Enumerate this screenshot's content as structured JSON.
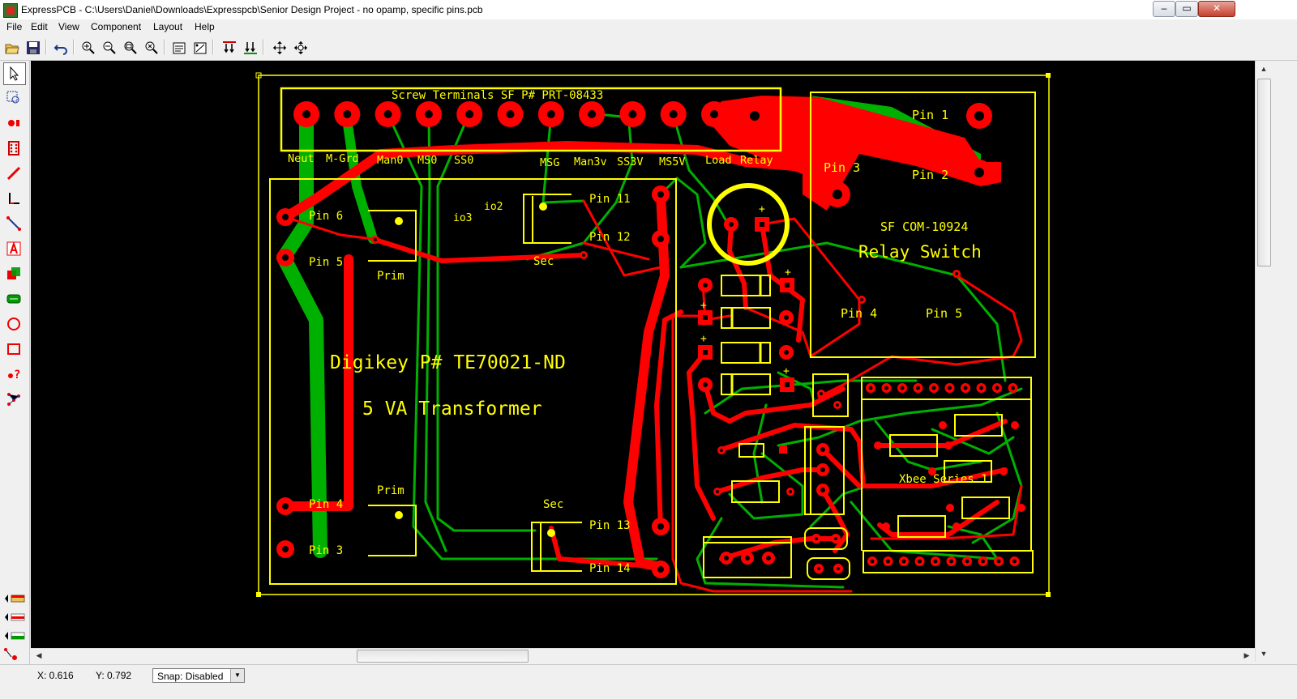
{
  "window": {
    "title": "ExpressPCB - C:\\Users\\Daniel\\Downloads\\Expresspcb\\Senior Design Project - no opamp, specific pins.pcb",
    "minimize": "–",
    "maximize": "▭",
    "close": "✕"
  },
  "menu": [
    "File",
    "Edit",
    "View",
    "Component",
    "Layout",
    "Help"
  ],
  "colors": {
    "canvas": "#000000",
    "silkscreen": "#ffff00",
    "top_copper": "#ff0000",
    "bottom_copper": "#00b000"
  },
  "board": {
    "screw_terminal_title": "Screw Terminals SF P# PRT-08433",
    "terminal_labels": [
      "Neut",
      "M-Grd",
      "Man0",
      "MS0",
      "SS0",
      "MSG",
      "Man3v",
      "SS3V",
      "MS5V",
      "Load",
      "Relay"
    ],
    "transformer_part": "Digikey P# TE70021-ND",
    "transformer_name": "5 VA Transformer",
    "pins": {
      "p1": "Pin 1",
      "p2": "Pin 2",
      "p3": "Pin 3",
      "p4": "Pin 4",
      "p5": "Pin 5",
      "p6": "Pin 6",
      "p11": "Pin 11",
      "p12": "Pin 12",
      "p13": "Pin 13",
      "p14": "Pin 14"
    },
    "prim": "Prim",
    "sec": "Sec",
    "io2": "io2",
    "io3": "io3",
    "relay_part": "SF COM-10924",
    "relay_name": "Relay Switch",
    "xbee": "Xbee Series 1",
    "plus": "+"
  },
  "status": {
    "x": "X: 0.616",
    "y": "Y: 0.792",
    "snap": "Snap: Disabled"
  }
}
